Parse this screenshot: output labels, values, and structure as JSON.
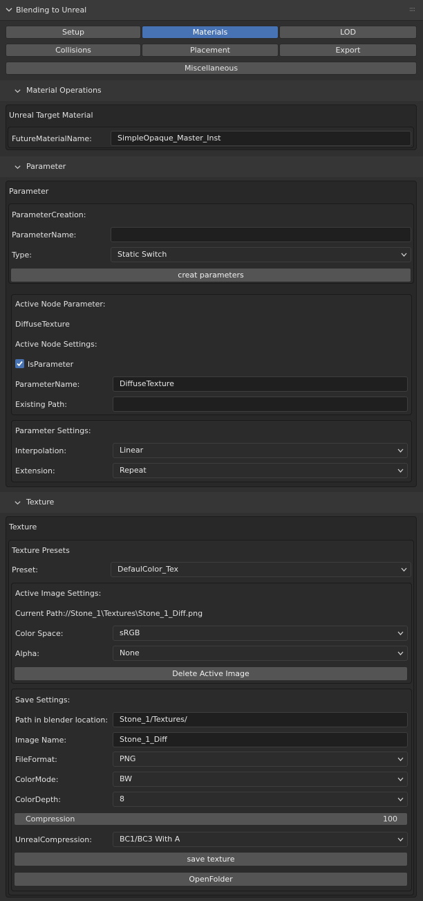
{
  "panel": {
    "title": "Blending to Unreal",
    "grip": "::::"
  },
  "tabs": [
    "Setup",
    "Materials",
    "LOD",
    "Collisions",
    "Placement",
    "Export",
    "Miscellaneous"
  ],
  "material_ops": {
    "header": "Material Operations",
    "box_title": "Unreal Target Material",
    "future_label": "FutureMaterialName:",
    "future_value": "SimpleOpaque_Master_Inst"
  },
  "parameter": {
    "header": "Parameter",
    "box_title": "Parameter",
    "creation": {
      "title": "ParameterCreation:",
      "name_label": "ParameterName:",
      "name_value": "",
      "type_label": "Type:",
      "type_value": "Static Switch",
      "create_button": "creat parameters"
    },
    "active_node": {
      "title": "Active Node Parameter:",
      "node_name": "DiffuseTexture",
      "settings_title": "Active Node Settings:",
      "is_parameter_label": "IsParameter",
      "param_name_label": "ParameterName:",
      "param_name_value": "DiffuseTexture",
      "existing_path_label": "Existing Path:",
      "existing_path_value": ""
    },
    "settings": {
      "title": "Parameter Settings:",
      "interp_label": "Interpolation:",
      "interp_value": "Linear",
      "ext_label": "Extension:",
      "ext_value": "Repeat"
    }
  },
  "texture": {
    "header": "Texture",
    "box_title": "Texture",
    "presets": {
      "title": "Texture Presets",
      "preset_label": "Preset:",
      "preset_value": "DefaulColor_Tex"
    },
    "active_image": {
      "title": "Active Image Settings:",
      "current_path": "Current Path://Stone_1\\Textures\\Stone_1_Diff.png",
      "color_space_label": "Color Space:",
      "color_space_value": "sRGB",
      "alpha_label": "Alpha:",
      "alpha_value": "None",
      "delete_button": "Delete Active Image"
    },
    "save": {
      "title": "Save Settings:",
      "path_label": "Path in blender location:",
      "path_value": "Stone_1/Textures/",
      "image_name_label": "Image Name:",
      "image_name_value": "Stone_1_Diff",
      "file_format_label": "FileFormat:",
      "file_format_value": "PNG",
      "color_mode_label": "ColorMode:",
      "color_mode_value": "BW",
      "color_depth_label": "ColorDepth:",
      "color_depth_value": "8",
      "compression_label": "Compression",
      "compression_value": "100",
      "unreal_comp_label": "UnrealCompression:",
      "unreal_comp_value": "BC1/BC3 With A",
      "save_button": "save texture",
      "open_folder_button": "OpenFolder"
    }
  },
  "colors": {
    "accent": "#4772b3",
    "background": "#303030",
    "box": "#282828",
    "field": "#1f1f1f"
  }
}
